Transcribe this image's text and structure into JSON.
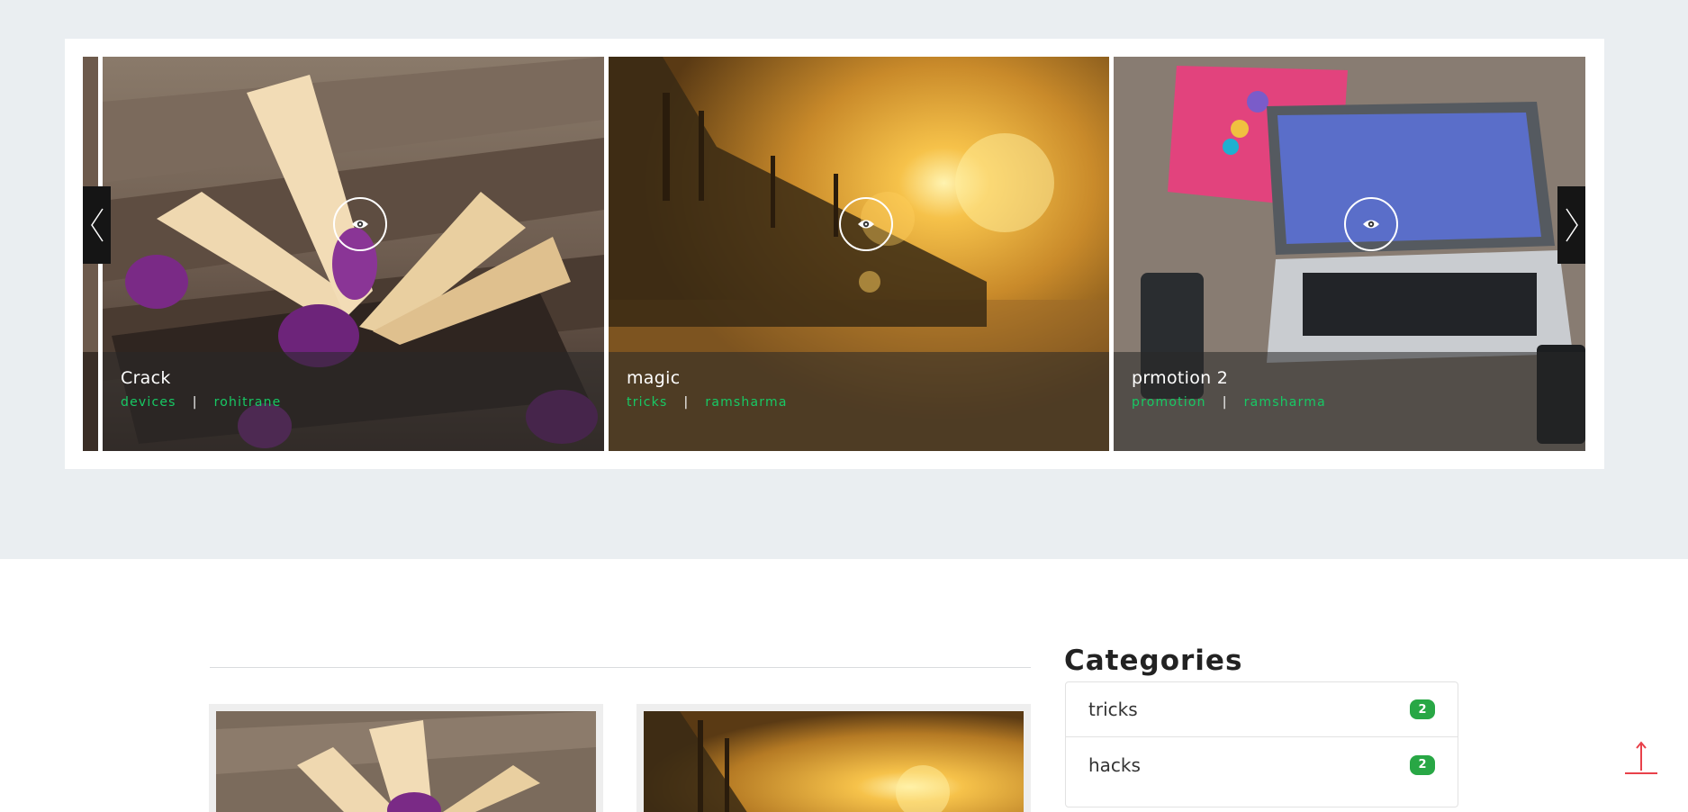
{
  "slider": {
    "slides": [
      {
        "title": "",
        "category": "",
        "author": ""
      },
      {
        "title": "Crack",
        "category": "devices",
        "author": "rohitrane"
      },
      {
        "title": "magic",
        "category": "tricks",
        "author": "ramsharma"
      },
      {
        "title": "prmotion 2",
        "category": "promotion",
        "author": "ramsharma"
      }
    ],
    "separator": "|",
    "prev_icon": "chevron-left-icon",
    "next_icon": "chevron-right-icon",
    "view_icon": "eye-icon"
  },
  "categories": {
    "title": "Categories",
    "items": [
      {
        "name": "tricks",
        "count": "2"
      },
      {
        "name": "hacks",
        "count": "2"
      }
    ]
  },
  "back_to_top_icon": "arrow-up-icon",
  "colors": {
    "accent_green": "#17c964",
    "badge_green": "#28a745",
    "band_bg": "#eaeef1",
    "back_to_top_red": "#e8414a"
  }
}
